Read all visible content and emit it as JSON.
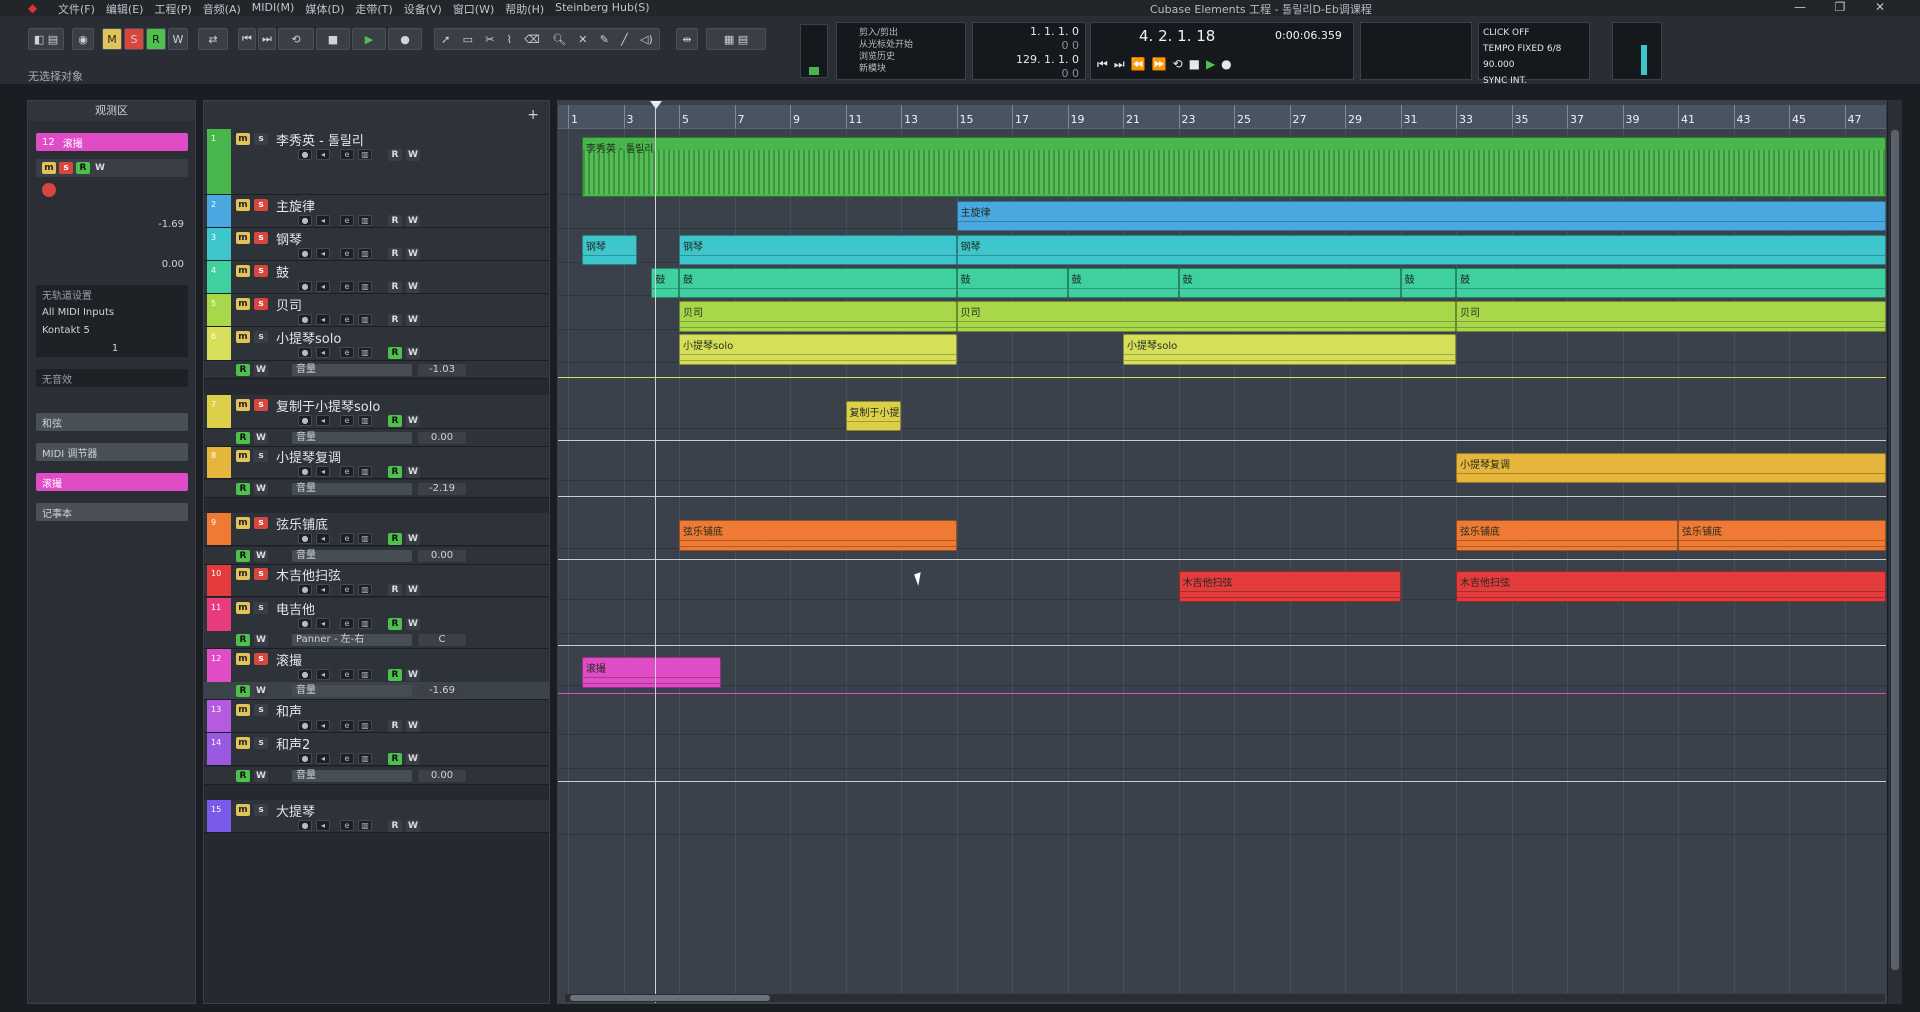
{
  "window": {
    "title": "Cubase Elements 工程 - 톨릴리D-Eb调课程",
    "menus": [
      "文件(F)",
      "编辑(E)",
      "工程(P)",
      "音频(A)",
      "MIDI(M)",
      "媒体(D)",
      "走带(T)",
      "设备(V)",
      "窗口(W)",
      "帮助(H)",
      "Steinberg Hub(S)"
    ]
  },
  "toolbar": {
    "mode_buttons": [
      "M",
      "S",
      "R",
      "W"
    ],
    "history": [
      "剪入/剪出",
      "从光标处开始",
      "浏览历史",
      "新模块"
    ],
    "left_locator": "1. 1. 1.  0",
    "left_locator_sub": "0    0",
    "right_locator": "129. 1. 1.  0",
    "right_locator_sub": "0    0",
    "position_bars": "4. 2. 1.  18",
    "position_time": "0:00:06.359",
    "click": "CLICK",
    "click_val": "OFF",
    "tempo": "TEMPO",
    "tempo_val": "FIXED",
    "tempo_sig": "6/8",
    "tempo_bpm": "90.000",
    "sync": "SYNC",
    "sync_val": "INT."
  },
  "info_line": "无选择对象",
  "inspector": {
    "title": "观测区",
    "track_num": "12",
    "track_name": "滚撮",
    "volume": "-1.69",
    "pan": "0.00",
    "input": "无轨道设置",
    "midi_in": "All MIDI Inputs",
    "midi_out": "Kontakt 5",
    "channel": "1",
    "patch": "无音效",
    "sections": [
      "和弦",
      "MIDI 调节器",
      "滚撮",
      "记事本"
    ]
  },
  "tracklist": {
    "tracks": [
      {
        "n": "1",
        "name": "李秀英 - 톨릴리",
        "color": "#48b64a",
        "s_on": false,
        "r_on": false
      },
      {
        "n": "2",
        "name": "主旋律",
        "color": "#4aa8e0",
        "s_on": true,
        "r_on": false
      },
      {
        "n": "3",
        "name": "钢琴",
        "color": "#3fc6cc",
        "s_on": true,
        "r_on": false
      },
      {
        "n": "4",
        "name": "鼓",
        "color": "#3fd0a0",
        "s_on": true,
        "r_on": false
      },
      {
        "n": "5",
        "name": "贝司",
        "color": "#a8d84a",
        "s_on": true,
        "r_on": false
      },
      {
        "n": "6",
        "name": "小提琴solo",
        "color": "#d7df5a",
        "s_on": false,
        "r_on": true
      },
      {
        "n": "7",
        "name": "复制于小提琴solo",
        "color": "#dcd04a",
        "s_on": true,
        "r_on": true
      },
      {
        "n": "8",
        "name": "小提琴复调",
        "color": "#e6b63c",
        "s_on": false,
        "r_on": true
      },
      {
        "n": "9",
        "name": "弦乐铺底",
        "color": "#ee7a34",
        "s_on": true,
        "r_on": true
      },
      {
        "n": "10",
        "name": "木吉他扫弦",
        "color": "#e43c3c",
        "s_on": true,
        "r_on": false
      },
      {
        "n": "11",
        "name": "电吉他",
        "color": "#e83c7e",
        "s_on": false,
        "r_on": true
      },
      {
        "n": "12",
        "name": "滚撮",
        "color": "#e04cc6",
        "s_on": true,
        "r_on": true
      },
      {
        "n": "13",
        "name": "和声",
        "color": "#b65ae0",
        "s_on": false,
        "r_on": false
      },
      {
        "n": "14",
        "name": "和声2",
        "color": "#9a5ae0",
        "s_on": false,
        "r_on": true
      },
      {
        "n": "15",
        "name": "大提琴",
        "color": "#7a5ae8",
        "s_on": false,
        "r_on": false
      }
    ],
    "auto": [
      {
        "label": "音量",
        "value": "-1.03"
      },
      {
        "label": "音量",
        "value": "0.00"
      },
      {
        "label": "音量",
        "value": "-2.19"
      },
      {
        "label": "音量",
        "value": "0.00"
      },
      {
        "label": "Panner - 左-右",
        "value": "C"
      },
      {
        "label": "音量",
        "value": "-1.69"
      },
      {
        "label": "音量",
        "value": "0.00"
      }
    ]
  },
  "ruler": {
    "bars": [
      "1",
      "3",
      "5",
      "7",
      "9",
      "11",
      "13",
      "15",
      "17",
      "19",
      "21",
      "23",
      "25",
      "27",
      "29",
      "31",
      "33",
      "35",
      "37",
      "39",
      "41",
      "43",
      "45",
      "47"
    ]
  },
  "clips": [
    {
      "label": "李秀英 - 톨릴리",
      "track": 0
    },
    {
      "label": "主旋律",
      "track": 1
    },
    {
      "label": "钢琴",
      "track": 2
    },
    {
      "label": "钢琴",
      "track": 2
    },
    {
      "label": "钢琴",
      "track": 2
    },
    {
      "label": "鼓",
      "track": 3
    },
    {
      "label": "鼓",
      "track": 3
    },
    {
      "label": "鼓",
      "track": 3
    },
    {
      "label": "鼓",
      "track": 3
    },
    {
      "label": "鼓",
      "track": 3
    },
    {
      "label": "鼓",
      "track": 3
    },
    {
      "label": "鼓",
      "track": 3
    },
    {
      "label": "贝司",
      "track": 4
    },
    {
      "label": "贝司",
      "track": 4
    },
    {
      "label": "贝司",
      "track": 4
    },
    {
      "label": "小提琴solo",
      "track": 5
    },
    {
      "label": "小提琴solo",
      "track": 5
    },
    {
      "label": "复制于小提琴solo",
      "track": 6
    },
    {
      "label": "小提琴复调",
      "track": 7
    },
    {
      "label": "弦乐铺底",
      "track": 8
    },
    {
      "label": "弦乐铺底",
      "track": 8
    },
    {
      "label": "弦乐铺底",
      "track": 8
    },
    {
      "label": "木吉他扫弦",
      "track": 9
    },
    {
      "label": "木吉他扫弦",
      "track": 9
    },
    {
      "label": "滚撮",
      "track": 11
    }
  ]
}
